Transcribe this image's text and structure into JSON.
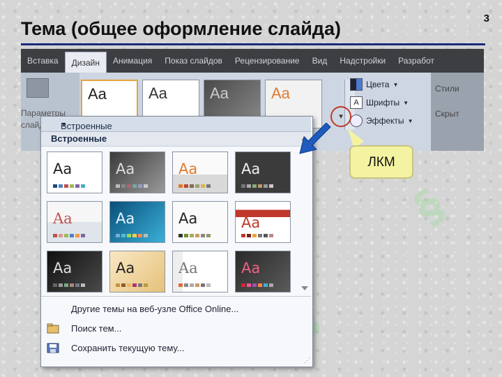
{
  "slide": {
    "title": "Тема (общее оформление слайда)",
    "number": "3"
  },
  "ribbon": {
    "tabs": [
      "Вставка",
      "Дизайн",
      "Анимация",
      "Показ слайдов",
      "Рецензирование",
      "Вид",
      "Надстройки",
      "Разработ"
    ],
    "active_tab": "Дизайн",
    "left_group_text_1": "Параметры",
    "left_group_text_2": "слайда",
    "commands": {
      "colors": "Цвета",
      "fonts": "Шрифты",
      "effects": "Эффекты"
    },
    "right_group": {
      "styles": "Стили",
      "hide": "Скрыт"
    }
  },
  "callout": {
    "label": "ЛКМ"
  },
  "gallery": {
    "header": "Встроенные",
    "section": "Встроенные",
    "thumb_text": "Aa"
  },
  "menu": {
    "online": "Другие темы на веб-узле Office Online...",
    "search": "Поиск тем...",
    "save": "Сохранить текущую тему..."
  },
  "colors": {
    "title_rule": "#1c2a7a",
    "callout_fill": "#f4f3a1",
    "highlight_circle": "#c0392b",
    "arrow": "#1f5bbd"
  }
}
